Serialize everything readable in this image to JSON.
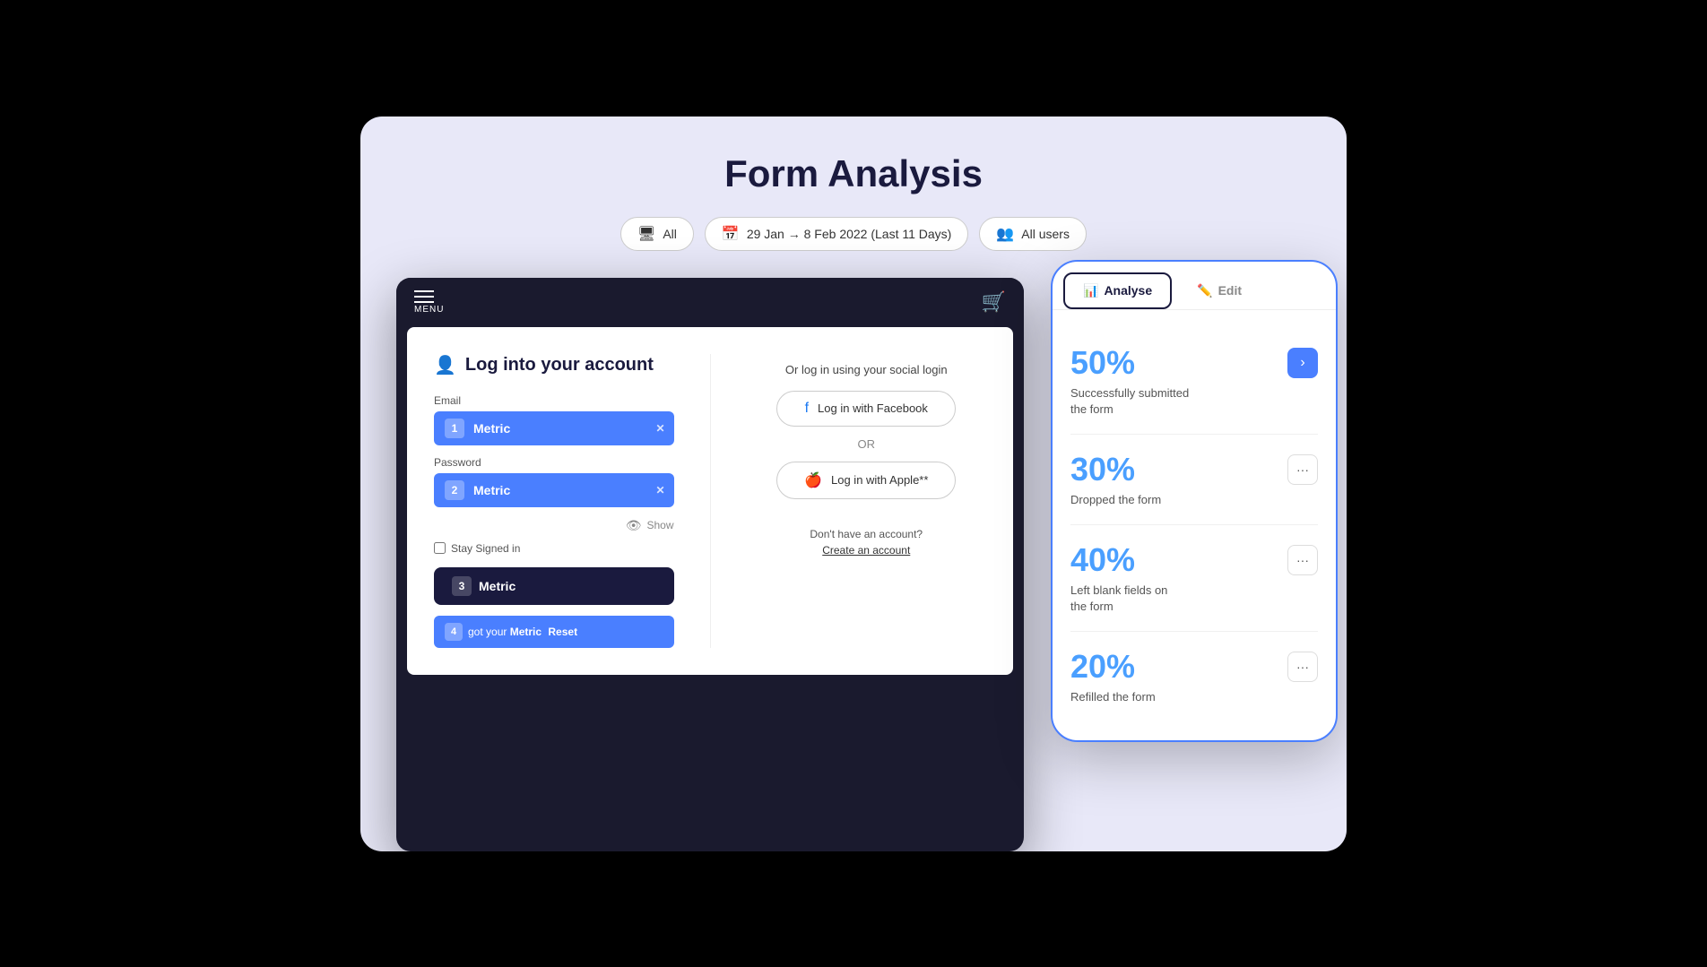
{
  "page": {
    "title": "Form Analysis"
  },
  "filters": [
    {
      "id": "all",
      "icon": "🖥",
      "label": "All"
    },
    {
      "id": "date",
      "icon": "📅",
      "label": "29 Jan → 8 Feb 2022 (Last 11 Days)"
    },
    {
      "id": "users",
      "icon": "👥",
      "label": "All users"
    }
  ],
  "tablet": {
    "menu_label": "MENU",
    "login_title": "Log into your account",
    "email_label": "Email",
    "password_label": "Password",
    "field1_num": "1",
    "field1_text": "Metric",
    "field2_num": "2",
    "field2_text": "Metric",
    "show_label": "Show",
    "stay_signed": "Stay Signed in",
    "login_btn_num": "3",
    "login_btn_text": "Metric",
    "forgot_num": "4",
    "forgot_text": "got your",
    "forgot_metric": "Metric",
    "forgot_reset": "Reset",
    "or_text": "OR",
    "social_title": "Or log in using your social login",
    "facebook_btn": "Log in with Facebook",
    "apple_btn": "Log in with Apple**",
    "no_account": "Don't have an account?",
    "create_account": "Create an account"
  },
  "phone": {
    "tab_analyse": "Analyse",
    "tab_edit": "Edit",
    "metrics": [
      {
        "percent": "50%",
        "label": "Successfully submitted\nthe form",
        "has_nav": true
      },
      {
        "percent": "30%",
        "label": "Dropped the form",
        "has_nav": false
      },
      {
        "percent": "40%",
        "label": "Left blank fields on\nthe form",
        "has_nav": false
      },
      {
        "percent": "20%",
        "label": "Refilled the form",
        "has_nav": false
      }
    ]
  }
}
